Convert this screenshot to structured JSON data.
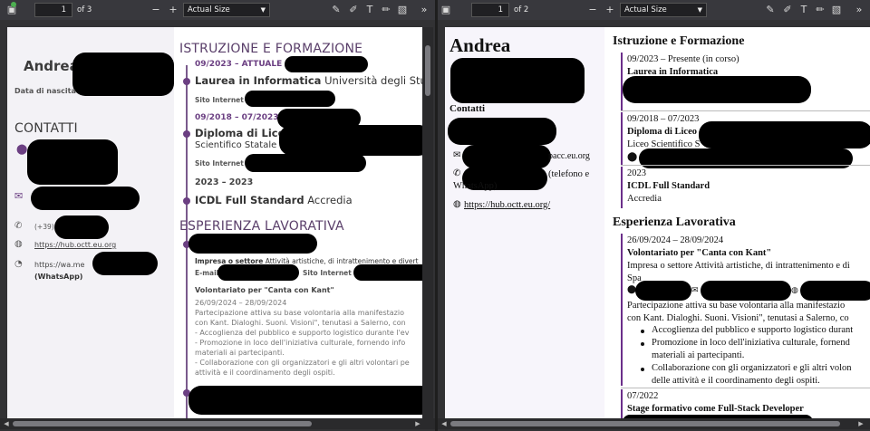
{
  "viewers": [
    {
      "page_value": "1",
      "page_of": "of 3",
      "zoom": "Actual Size"
    },
    {
      "page_value": "1",
      "page_of": "of 2",
      "zoom": "Actual Size"
    }
  ],
  "left_doc": {
    "name": "Andrea",
    "birth_label": "Data di nascita",
    "contacts_title": "CONTATTI",
    "phone_prefix": "(+39)",
    "website": "https://hub.octt.eu.org",
    "whatsapp": "https://wa.me",
    "whatsapp_label": "(WhatsApp)",
    "edu_title": "ISTRUZIONE E FORMAZIONE",
    "edu1_date": "09/2023 – ATTUALE",
    "edu1_title": "Laurea in Informatica",
    "edu1_inst": "Università degli Studi di S",
    "site_label": "Sito Internet",
    "edu2_date": "09/2018 – 07/2023",
    "edu2_title": "Diploma di Liceo",
    "edu2_inst": "Scientifico Statale",
    "edu3_date": "2023 – 2023",
    "edu3_title": "ICDL Full Standard",
    "edu3_inst": "Accredia",
    "exp_title": "ESPERIENZA LAVORATIVA",
    "sector_label": "Impresa o settore",
    "sector_value": "Attività artistiche, di intrattenimento e divert",
    "email_label": "E-mail",
    "site_label2": "Sito Internet",
    "role": "Volontariato per \"Canta con Kant\"",
    "role_dates": "26/09/2024 – 28/09/2024",
    "desc": [
      "Partecipazione attiva su base volontaria alla manifestazio",
      "con Kant. Dialoghi. Suoni. Visioni\", tenutasi a Salerno, con",
      "- Accoglienza del pubblico e supporto logistico durante l'ev",
      "- Promozione in loco dell'iniziativa culturale, fornendo info",
      "materiali ai partecipanti.",
      "- Collaborazione con gli organizzatori e gli altri volontari pe",
      "attività e il coordinamento degli ospiti."
    ]
  },
  "right_doc": {
    "name": "Andrea",
    "contacts": "Contatti",
    "email_tail": "pacc.eu.org",
    "phone_tail": "(telefono e",
    "whatsapp": "WhatsApp)",
    "website": "https://hub.octt.eu.org/",
    "edu_title": "Istruzione e Formazione",
    "e1_date": "09/2023 – Presente (in corso)",
    "e1_title": "Laurea in Informatica",
    "e2_date": "09/2018 – 07/2023",
    "e2_title": "Diploma di Liceo",
    "e2_inst": "Liceo Scientifico S",
    "e3_date": "2023",
    "e3_title": "ICDL Full Standard",
    "e3_inst": "Accredia",
    "exp_title": "Esperienza Lavorativa",
    "x1_date": "26/09/2024 – 28/09/2024",
    "x1_title": "Volontariato per \"Canta con Kant\"",
    "x1_sector": "Impresa o settore Attività artistiche, di intrattenimento e di",
    "x1_spa": "Spa",
    "x1_desc1": "Partecipazione attiva su base volontaria alla manifestazio",
    "x1_desc2": "con Kant. Dialoghi. Suoni. Visioni\", tenutasi a Salerno, co",
    "bullets": [
      "Accoglienza del pubblico e supporto logistico durant",
      "Promozione in loco dell'iniziativa culturale, fornend",
      "materiali ai partecipanti.",
      "Collaborazione con gli organizzatori e gli altri volon",
      "delle attività e il coordinamento degli ospiti."
    ],
    "x2_date": "07/2022",
    "x2_title": "Stage formativo come Full-Stack Developer"
  }
}
